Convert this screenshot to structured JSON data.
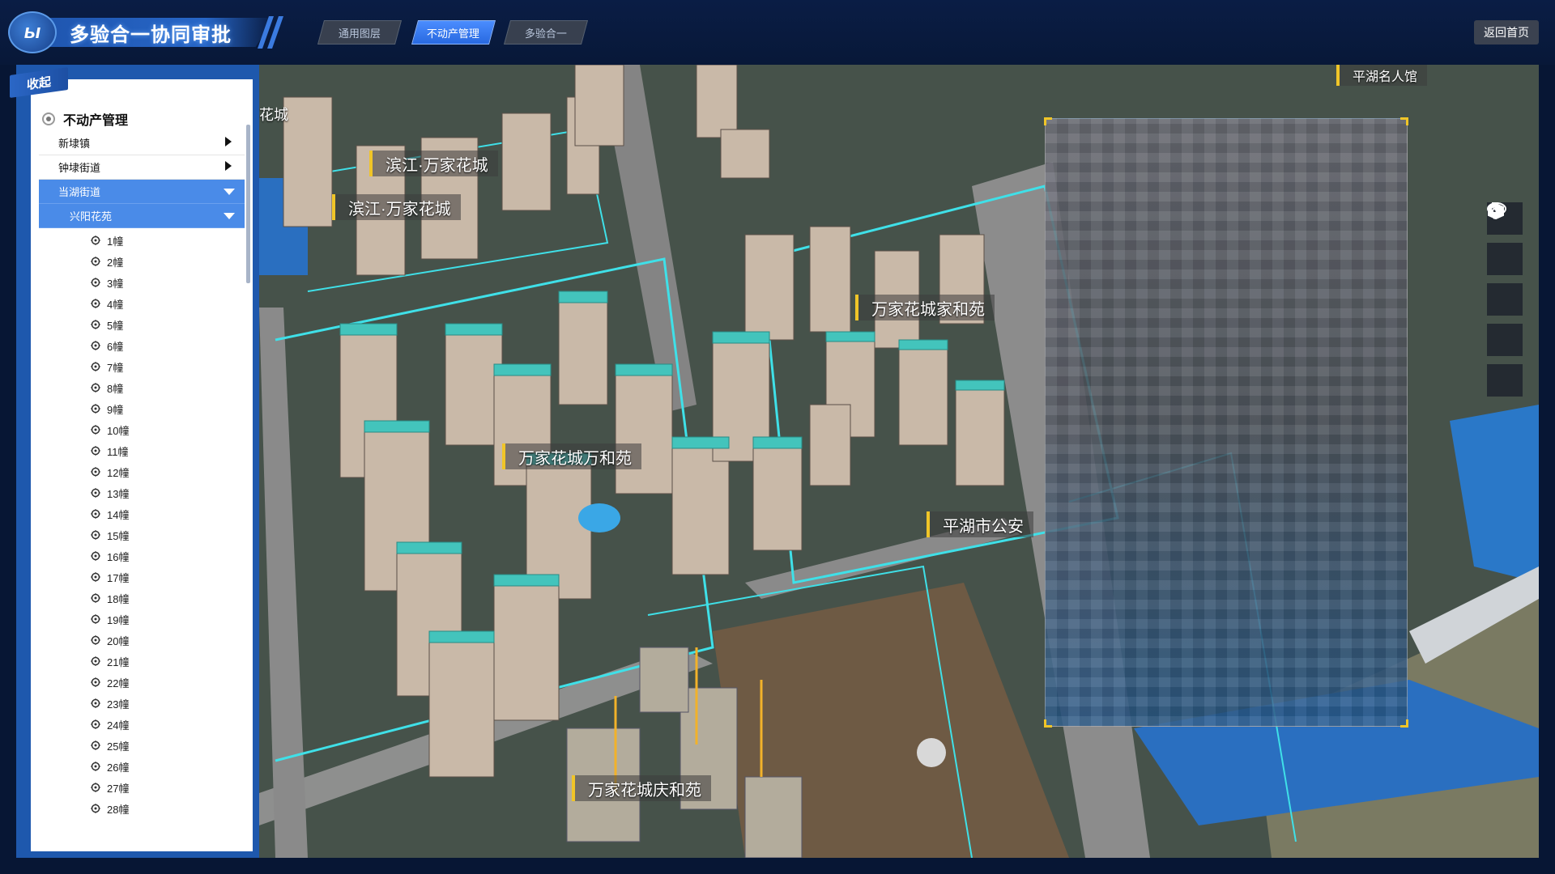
{
  "header": {
    "title": "多验合一协同审批",
    "tabs": [
      {
        "label": "通用图层",
        "active": false
      },
      {
        "label": "不动产管理",
        "active": true
      },
      {
        "label": "多验合一",
        "active": false
      }
    ],
    "home_label": "返回首页"
  },
  "sidebar": {
    "collapse_label": "收起",
    "root_label": "不动产管理",
    "rows": [
      {
        "label": "新埭镇",
        "expanded": false
      },
      {
        "label": "钟埭街道",
        "expanded": false
      },
      {
        "label": "当湖街道",
        "expanded": true
      },
      {
        "label": "兴阳花苑",
        "expanded": true
      }
    ],
    "buildings": [
      "1幢",
      "2幢",
      "3幢",
      "4幢",
      "5幢",
      "6幢",
      "7幢",
      "8幢",
      "9幢",
      "10幢",
      "11幢",
      "12幢",
      "13幢",
      "14幢",
      "15幢",
      "16幢",
      "17幢",
      "18幢",
      "19幢",
      "20幢",
      "21幢",
      "22幢",
      "23幢",
      "24幢",
      "25幢",
      "26幢",
      "27幢",
      "28幢"
    ]
  },
  "map": {
    "labels": {
      "l1": "滨江·万家花城",
      "l2": "滨江·万家花城",
      "l3": "万家花城家和苑",
      "l4": "万家花城万和苑",
      "l5": "平湖市公安",
      "l6": "万家花城庆和苑",
      "l7": "平湖名人馆",
      "l8": "花城"
    },
    "tools": [
      "briefcase-icon",
      "location-pin-icon",
      "cube-icon",
      "eye-icon",
      "gear-icon"
    ]
  },
  "colors": {
    "accent": "#2869e0",
    "sidebar": "#1e58ad",
    "selected_row": "#4a8be8",
    "label_marker": "#f0c528",
    "boundary": "#3fe0e8"
  }
}
